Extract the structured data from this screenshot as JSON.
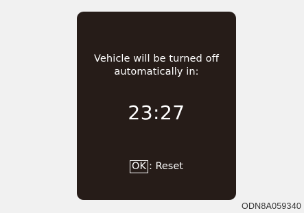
{
  "screen": {
    "message_line1": "Vehicle will be turned off",
    "message_line2": "automatically in:",
    "countdown": "23:27",
    "ok_key_label": "OK",
    "reset_label": ": Reset"
  },
  "caption": {
    "reference_code": "ODN8A059340"
  },
  "colors": {
    "page_background": "#f1f1f1",
    "screen_background": "#261c18",
    "screen_text": "#ffffff"
  }
}
